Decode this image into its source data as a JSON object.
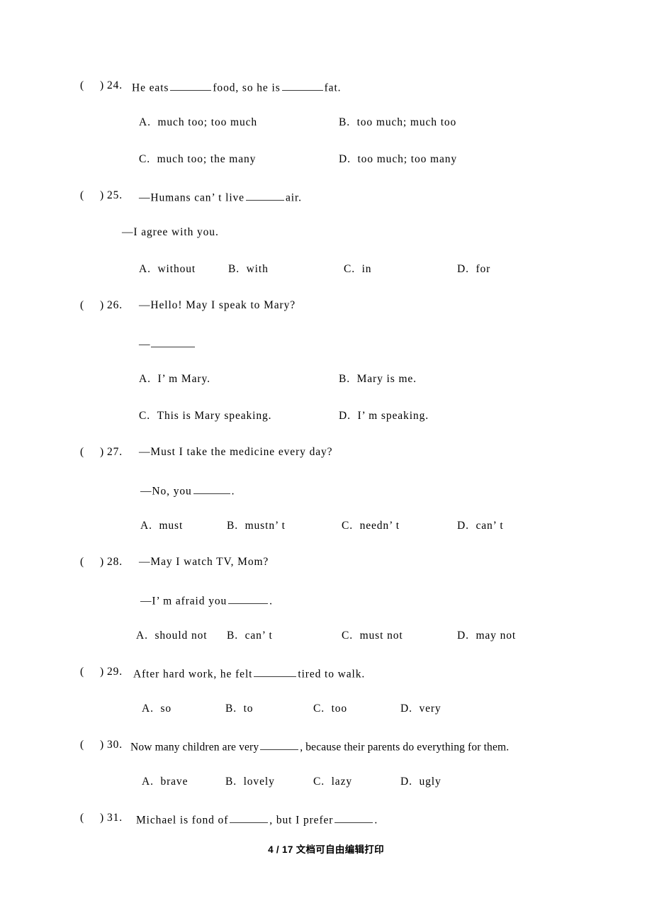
{
  "document": {
    "type": "english-exam-worksheet",
    "section": "multiple-choice",
    "page_label": "4 / 17 文档可自由编辑打印",
    "bracket_open": "(",
    "bracket_close": ")"
  },
  "questions": [
    {
      "number": "24.",
      "stem_before": "He eats",
      "stem_middle": "food, so he is",
      "stem_after": "fat.",
      "options": [
        {
          "letter": "A.",
          "text": "much too; too much"
        },
        {
          "letter": "B.",
          "text": "too much; much too"
        },
        {
          "letter": "C.",
          "text": "much too; the many"
        },
        {
          "letter": "D.",
          "text": "too much; too many"
        }
      ]
    },
    {
      "number": "25.",
      "stem_before": "—Humans can’ t live",
      "stem_after": "air.",
      "reply": "—I agree with you.",
      "options": [
        {
          "letter": "A.",
          "text": "without"
        },
        {
          "letter": "B.",
          "text": "with"
        },
        {
          "letter": "C.",
          "text": "in"
        },
        {
          "letter": "D.",
          "text": "for"
        }
      ]
    },
    {
      "number": "26.",
      "stem": "—Hello! May I speak to Mary?",
      "reply_dash": "—",
      "options": [
        {
          "letter": "A.",
          "text": "I’ m Mary."
        },
        {
          "letter": "B.",
          "text": "Mary is me."
        },
        {
          "letter": "C.",
          "text": "This is Mary speaking."
        },
        {
          "letter": "D.",
          "text": "I’ m speaking."
        }
      ]
    },
    {
      "number": "27.",
      "stem": "—Must I take the medicine every day?",
      "reply_before": "—No, you",
      "reply_after": ".",
      "options": [
        {
          "letter": "A.",
          "text": "must"
        },
        {
          "letter": "B.",
          "text": "mustn’ t"
        },
        {
          "letter": "C.",
          "text": "needn’ t"
        },
        {
          "letter": "D.",
          "text": "can’ t"
        }
      ]
    },
    {
      "number": "28.",
      "stem": "—May I watch TV, Mom?",
      "reply_before": "—I’ m afraid you",
      "reply_after": ".",
      "options": [
        {
          "letter": "A.",
          "text": "should not"
        },
        {
          "letter": "B.",
          "text": "can’ t"
        },
        {
          "letter": "C.",
          "text": "must not"
        },
        {
          "letter": "D.",
          "text": "may not"
        }
      ]
    },
    {
      "number": "29.",
      "stem_before": "After hard work, he felt",
      "stem_after": "tired to walk.",
      "options": [
        {
          "letter": "A.",
          "text": "so"
        },
        {
          "letter": "B.",
          "text": "to"
        },
        {
          "letter": "C.",
          "text": "too"
        },
        {
          "letter": "D.",
          "text": "very"
        }
      ]
    },
    {
      "number": "30.",
      "stem_before": "Now many children are very",
      "stem_after": ", because their parents do everything for them.",
      "options": [
        {
          "letter": "A.",
          "text": "brave"
        },
        {
          "letter": "B.",
          "text": "lovely"
        },
        {
          "letter": "C.",
          "text": "lazy"
        },
        {
          "letter": "D.",
          "text": "ugly"
        }
      ]
    },
    {
      "number": "31.",
      "stem_before": "Michael is fond of",
      "stem_middle": ", but I prefer",
      "stem_after": "."
    }
  ]
}
